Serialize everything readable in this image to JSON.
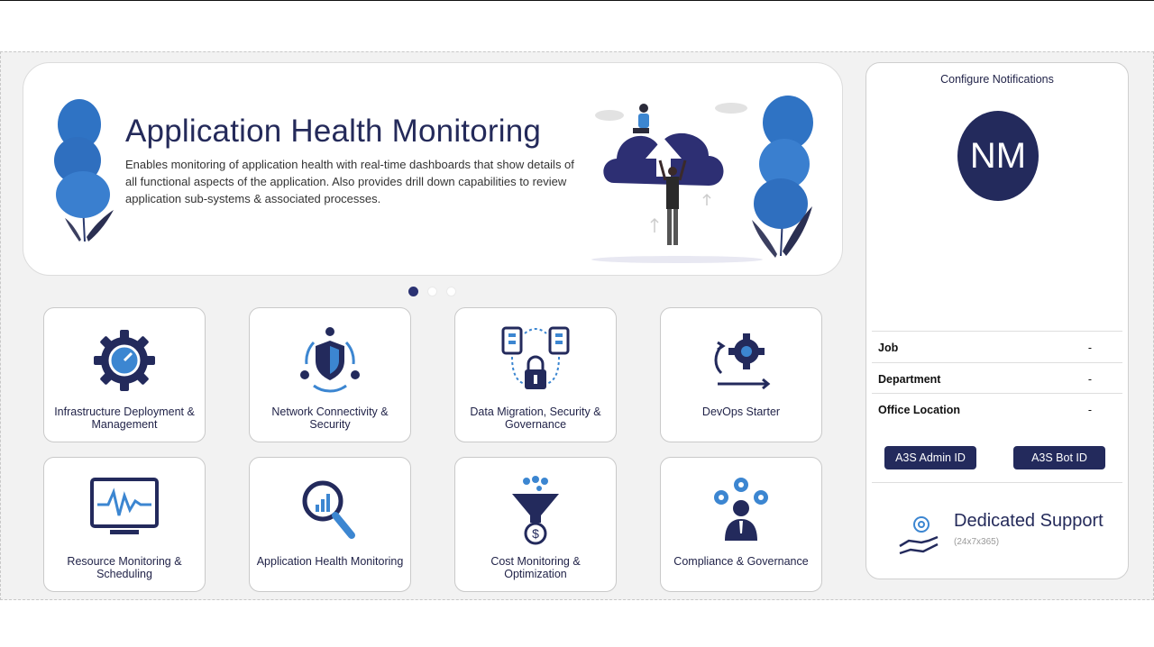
{
  "banner": {
    "title": "Application Health Monitoring",
    "description": "Enables monitoring of application health with real-time dashboards that show details of all functional aspects of the application. Also provides drill down capabilities to review application sub-systems & associated processes."
  },
  "carousel": {
    "active_index": 0,
    "count": 3
  },
  "tiles": [
    {
      "label": "Infrastructure Deployment & Management",
      "icon": "gear-gauge-icon"
    },
    {
      "label": "Network Connectivity & Security",
      "icon": "shield-network-icon"
    },
    {
      "label": "Data Migration, Security & Governance",
      "icon": "database-lock-icon"
    },
    {
      "label": "DevOps Starter",
      "icon": "gears-cycle-icon"
    },
    {
      "label": "Resource Monitoring & Scheduling",
      "icon": "monitor-pulse-icon"
    },
    {
      "label": "Application Health Monitoring",
      "icon": "magnifier-chart-icon"
    },
    {
      "label": "Cost Monitoring & Optimization",
      "icon": "funnel-dollar-icon"
    },
    {
      "label": "Compliance & Governance",
      "icon": "person-gears-icon"
    }
  ],
  "panel": {
    "title": "Configure Notifications",
    "avatar_initials": "NM",
    "fields": [
      {
        "label": "Job",
        "value": "-"
      },
      {
        "label": "Department",
        "value": "-"
      },
      {
        "label": "Office Location",
        "value": "-"
      }
    ],
    "admin_button": "A3S Admin ID",
    "bot_button": "A3S Bot ID",
    "support_title": "Dedicated Support",
    "support_sub": "(24x7x365)"
  },
  "colors": {
    "navy": "#232a5c",
    "accent_blue": "#2f7ac4",
    "canvas_bg": "#f2f2f2"
  }
}
